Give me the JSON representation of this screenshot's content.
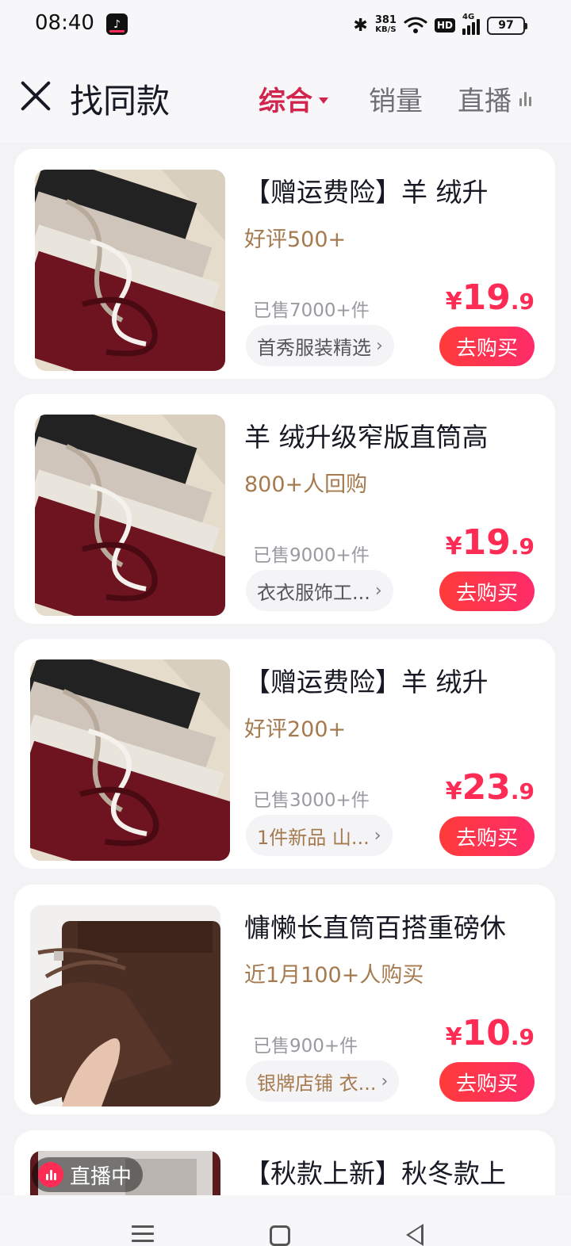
{
  "status_bar": {
    "time": "08:40",
    "net_speed_value": "381",
    "net_speed_unit": "KB/S",
    "hd": "HD",
    "signal_label": "4G",
    "battery": "97"
  },
  "header": {
    "title": "找同款",
    "tabs": [
      {
        "label": "综合",
        "active": true
      },
      {
        "label": "销量",
        "active": false
      },
      {
        "label": "直播",
        "active": false
      }
    ]
  },
  "products": [
    {
      "title": "【赠运费险】羊 绒升",
      "highlight": "好评500+",
      "sold": "已售7000+件",
      "shop": "首秀服装精选",
      "price_currency": "¥",
      "price_int": "19",
      "price_dec": ".9",
      "buy_label": "去购买"
    },
    {
      "title": "羊 绒升级窄版直筒高",
      "highlight": "800+人回购",
      "sold": "已售9000+件",
      "shop": "衣衣服饰工...",
      "price_currency": "¥",
      "price_int": "19",
      "price_dec": ".9",
      "buy_label": "去购买"
    },
    {
      "title": "【赠运费险】羊 绒升",
      "highlight": "好评200+",
      "sold": "已售3000+件",
      "shop": "1件新品  山...",
      "price_currency": "¥",
      "price_int": "23",
      "price_dec": ".9",
      "buy_label": "去购买"
    },
    {
      "title": "慵懒长直筒百搭重磅休",
      "highlight": "近1月100+人购买",
      "sold": "已售900+件",
      "shop": "银牌店铺  衣...",
      "price_currency": "¥",
      "price_int": "10",
      "price_dec": ".9",
      "buy_label": "去购买"
    },
    {
      "title": "【秋款上新】秋冬款上",
      "live_label": "直播中"
    }
  ],
  "colors": {
    "accent": "#fe2c55",
    "tab_active": "#d2254e",
    "highlight": "#a57a4f",
    "background": "#f3f3f6"
  },
  "icons": {
    "close": "close-icon",
    "chevron": "chevron-right-icon",
    "live": "live-bars-icon"
  }
}
